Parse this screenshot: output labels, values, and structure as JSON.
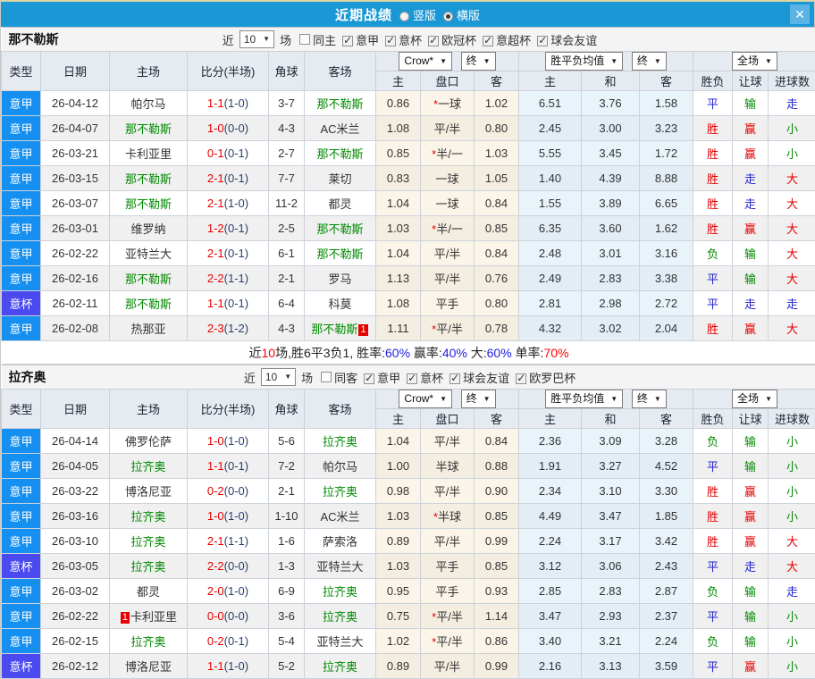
{
  "header": {
    "title": "近期战绩",
    "layout_options": [
      {
        "label": "竖版",
        "selected": false
      },
      {
        "label": "横版",
        "selected": true
      }
    ]
  },
  "table": {
    "columns": [
      "类型",
      "日期",
      "主场",
      "比分(半场)",
      "角球",
      "客场"
    ],
    "subcolumns": [
      "主",
      "盘口",
      "客",
      "主",
      "和",
      "客",
      "胜负",
      "让球",
      "进球数"
    ],
    "dropdowns": {
      "provider": "Crow*",
      "final_a": "终",
      "average": "胜平负均值",
      "final_b": "终",
      "scope": "全场"
    }
  },
  "colors": {
    "type": {
      "意甲": "#1590f0",
      "意杯": "#4a4af0"
    },
    "result": {
      "胜": "res-red",
      "赢": "res-red",
      "大": "res-red",
      "平": "res-blue",
      "走": "res-blue",
      "负": "res-green",
      "输": "res-green",
      "小": "res-green"
    },
    "focus_team": "#008a00",
    "score": "#e60000",
    "title_bar": "#1a98d5"
  },
  "sections": [
    {
      "team": "那不勒斯",
      "filters": {
        "near_label": "近",
        "count": "10",
        "unit": "场",
        "same_label": "同主",
        "same_checked": false,
        "leagues": [
          {
            "label": "意甲",
            "checked": true
          },
          {
            "label": "意杯",
            "checked": true
          },
          {
            "label": "欧冠杯",
            "checked": true
          },
          {
            "label": "意超杯",
            "checked": true
          },
          {
            "label": "球会友谊",
            "checked": true
          }
        ]
      },
      "rows": [
        {
          "type": "意甲",
          "date": "26-04-12",
          "home": {
            "name": "帕尔马"
          },
          "score": "1-1",
          "half": "(1-0)",
          "corner": "3-7",
          "away": {
            "name": "那不勒斯",
            "focus": true
          },
          "asian": [
            "0.86",
            "*一球",
            "1.02"
          ],
          "euro": [
            "6.51",
            "3.76",
            "1.58"
          ],
          "results": [
            "平",
            "输",
            "走"
          ]
        },
        {
          "type": "意甲",
          "date": "26-04-07",
          "home": {
            "name": "那不勒斯",
            "focus": true
          },
          "score": "1-0",
          "half": "(0-0)",
          "corner": "4-3",
          "away": {
            "name": "AC米兰"
          },
          "asian": [
            "1.08",
            "平/半",
            "0.80"
          ],
          "euro": [
            "2.45",
            "3.00",
            "3.23"
          ],
          "results": [
            "胜",
            "赢",
            "小"
          ]
        },
        {
          "type": "意甲",
          "date": "26-03-21",
          "home": {
            "name": "卡利亚里"
          },
          "score": "0-1",
          "half": "(0-1)",
          "corner": "2-7",
          "away": {
            "name": "那不勒斯",
            "focus": true
          },
          "asian": [
            "0.85",
            "*半/一",
            "1.03"
          ],
          "euro": [
            "5.55",
            "3.45",
            "1.72"
          ],
          "results": [
            "胜",
            "赢",
            "小"
          ]
        },
        {
          "type": "意甲",
          "date": "26-03-15",
          "home": {
            "name": "那不勒斯",
            "focus": true
          },
          "score": "2-1",
          "half": "(0-1)",
          "corner": "7-7",
          "away": {
            "name": "莱切"
          },
          "asian": [
            "0.83",
            "一球",
            "1.05"
          ],
          "euro": [
            "1.40",
            "4.39",
            "8.88"
          ],
          "results": [
            "胜",
            "走",
            "大"
          ]
        },
        {
          "type": "意甲",
          "date": "26-03-07",
          "home": {
            "name": "那不勒斯",
            "focus": true
          },
          "score": "2-1",
          "half": "(1-0)",
          "corner": "11-2",
          "away": {
            "name": "都灵"
          },
          "asian": [
            "1.04",
            "一球",
            "0.84"
          ],
          "euro": [
            "1.55",
            "3.89",
            "6.65"
          ],
          "results": [
            "胜",
            "走",
            "大"
          ]
        },
        {
          "type": "意甲",
          "date": "26-03-01",
          "home": {
            "name": "维罗纳"
          },
          "score": "1-2",
          "half": "(0-1)",
          "corner": "2-5",
          "away": {
            "name": "那不勒斯",
            "focus": true
          },
          "asian": [
            "1.03",
            "*半/一",
            "0.85"
          ],
          "euro": [
            "6.35",
            "3.60",
            "1.62"
          ],
          "results": [
            "胜",
            "赢",
            "大"
          ]
        },
        {
          "type": "意甲",
          "date": "26-02-22",
          "home": {
            "name": "亚特兰大"
          },
          "score": "2-1",
          "half": "(0-1)",
          "corner": "6-1",
          "away": {
            "name": "那不勒斯",
            "focus": true
          },
          "asian": [
            "1.04",
            "平/半",
            "0.84"
          ],
          "euro": [
            "2.48",
            "3.01",
            "3.16"
          ],
          "results": [
            "负",
            "输",
            "大"
          ]
        },
        {
          "type": "意甲",
          "date": "26-02-16",
          "home": {
            "name": "那不勒斯",
            "focus": true
          },
          "score": "2-2",
          "half": "(1-1)",
          "corner": "2-1",
          "away": {
            "name": "罗马"
          },
          "asian": [
            "1.13",
            "平/半",
            "0.76"
          ],
          "euro": [
            "2.49",
            "2.83",
            "3.38"
          ],
          "results": [
            "平",
            "输",
            "大"
          ]
        },
        {
          "type": "意杯",
          "date": "26-02-11",
          "home": {
            "name": "那不勒斯",
            "focus": true
          },
          "score": "1-1",
          "half": "(0-1)",
          "corner": "6-4",
          "away": {
            "name": "科莫"
          },
          "asian": [
            "1.08",
            "平手",
            "0.80"
          ],
          "euro": [
            "2.81",
            "2.98",
            "2.72"
          ],
          "results": [
            "平",
            "走",
            "走"
          ]
        },
        {
          "type": "意甲",
          "date": "26-02-08",
          "home": {
            "name": "热那亚"
          },
          "score": "2-3",
          "half": "(1-2)",
          "corner": "4-3",
          "away": {
            "name": "那不勒斯",
            "focus": true,
            "badge": "1",
            "badge_pos": "after"
          },
          "asian": [
            "1.11",
            "*平/半",
            "0.78"
          ],
          "euro": [
            "4.32",
            "3.02",
            "2.04"
          ],
          "results": [
            "胜",
            "赢",
            "大"
          ]
        }
      ],
      "summary": [
        {
          "t": "近",
          "c": "k"
        },
        {
          "t": "10",
          "c": "r"
        },
        {
          "t": "场,胜6平3负1, 胜率:",
          "c": "k"
        },
        {
          "t": "60%",
          "c": "b"
        },
        {
          "t": " 赢率:",
          "c": "k"
        },
        {
          "t": "40%",
          "c": "b"
        },
        {
          "t": " 大:",
          "c": "k"
        },
        {
          "t": "60%",
          "c": "b"
        },
        {
          "t": " 单率:",
          "c": "k"
        },
        {
          "t": "70%",
          "c": "r"
        }
      ]
    },
    {
      "team": "拉齐奥",
      "filters": {
        "near_label": "近",
        "count": "10",
        "unit": "场",
        "same_label": "同客",
        "same_checked": false,
        "leagues": [
          {
            "label": "意甲",
            "checked": true
          },
          {
            "label": "意杯",
            "checked": true
          },
          {
            "label": "球会友谊",
            "checked": true
          },
          {
            "label": "欧罗巴杯",
            "checked": true
          }
        ]
      },
      "rows": [
        {
          "type": "意甲",
          "date": "26-04-14",
          "home": {
            "name": "佛罗伦萨"
          },
          "score": "1-0",
          "half": "(1-0)",
          "corner": "5-6",
          "away": {
            "name": "拉齐奥",
            "focus": true
          },
          "asian": [
            "1.04",
            "平/半",
            "0.84"
          ],
          "euro": [
            "2.36",
            "3.09",
            "3.28"
          ],
          "results": [
            "负",
            "输",
            "小"
          ]
        },
        {
          "type": "意甲",
          "date": "26-04-05",
          "home": {
            "name": "拉齐奥",
            "focus": true
          },
          "score": "1-1",
          "half": "(0-1)",
          "corner": "7-2",
          "away": {
            "name": "帕尔马"
          },
          "asian": [
            "1.00",
            "半球",
            "0.88"
          ],
          "euro": [
            "1.91",
            "3.27",
            "4.52"
          ],
          "results": [
            "平",
            "输",
            "小"
          ]
        },
        {
          "type": "意甲",
          "date": "26-03-22",
          "home": {
            "name": "博洛尼亚"
          },
          "score": "0-2",
          "half": "(0-0)",
          "corner": "2-1",
          "away": {
            "name": "拉齐奥",
            "focus": true
          },
          "asian": [
            "0.98",
            "平/半",
            "0.90"
          ],
          "euro": [
            "2.34",
            "3.10",
            "3.30"
          ],
          "results": [
            "胜",
            "赢",
            "小"
          ]
        },
        {
          "type": "意甲",
          "date": "26-03-16",
          "home": {
            "name": "拉齐奥",
            "focus": true
          },
          "score": "1-0",
          "half": "(1-0)",
          "corner": "1-10",
          "away": {
            "name": "AC米兰"
          },
          "asian": [
            "1.03",
            "*半球",
            "0.85"
          ],
          "euro": [
            "4.49",
            "3.47",
            "1.85"
          ],
          "results": [
            "胜",
            "赢",
            "小"
          ]
        },
        {
          "type": "意甲",
          "date": "26-03-10",
          "home": {
            "name": "拉齐奥",
            "focus": true
          },
          "score": "2-1",
          "half": "(1-1)",
          "corner": "1-6",
          "away": {
            "name": "萨索洛"
          },
          "asian": [
            "0.89",
            "平/半",
            "0.99"
          ],
          "euro": [
            "2.24",
            "3.17",
            "3.42"
          ],
          "results": [
            "胜",
            "赢",
            "大"
          ]
        },
        {
          "type": "意杯",
          "date": "26-03-05",
          "home": {
            "name": "拉齐奥",
            "focus": true
          },
          "score": "2-2",
          "half": "(0-0)",
          "corner": "1-3",
          "away": {
            "name": "亚特兰大"
          },
          "asian": [
            "1.03",
            "平手",
            "0.85"
          ],
          "euro": [
            "3.12",
            "3.06",
            "2.43"
          ],
          "results": [
            "平",
            "走",
            "大"
          ]
        },
        {
          "type": "意甲",
          "date": "26-03-02",
          "home": {
            "name": "都灵"
          },
          "score": "2-0",
          "half": "(1-0)",
          "corner": "6-9",
          "away": {
            "name": "拉齐奥",
            "focus": true
          },
          "asian": [
            "0.95",
            "平手",
            "0.93"
          ],
          "euro": [
            "2.85",
            "2.83",
            "2.87"
          ],
          "results": [
            "负",
            "输",
            "走"
          ]
        },
        {
          "type": "意甲",
          "date": "26-02-22",
          "home": {
            "name": "卡利亚里",
            "badge": "1",
            "badge_pos": "before"
          },
          "score": "0-0",
          "half": "(0-0)",
          "corner": "3-6",
          "away": {
            "name": "拉齐奥",
            "focus": true
          },
          "asian": [
            "0.75",
            "*平/半",
            "1.14"
          ],
          "euro": [
            "3.47",
            "2.93",
            "2.37"
          ],
          "results": [
            "平",
            "输",
            "小"
          ]
        },
        {
          "type": "意甲",
          "date": "26-02-15",
          "home": {
            "name": "拉齐奥",
            "focus": true
          },
          "score": "0-2",
          "half": "(0-1)",
          "corner": "5-4",
          "away": {
            "name": "亚特兰大"
          },
          "asian": [
            "1.02",
            "*平/半",
            "0.86"
          ],
          "euro": [
            "3.40",
            "3.21",
            "2.24"
          ],
          "results": [
            "负",
            "输",
            "小"
          ]
        },
        {
          "type": "意杯",
          "date": "26-02-12",
          "home": {
            "name": "博洛尼亚"
          },
          "score": "1-1",
          "half": "(1-0)",
          "corner": "5-2",
          "away": {
            "name": "拉齐奥",
            "focus": true
          },
          "asian": [
            "0.89",
            "平/半",
            "0.99"
          ],
          "euro": [
            "2.16",
            "3.13",
            "3.59"
          ],
          "results": [
            "平",
            "赢",
            "小"
          ]
        }
      ]
    }
  ]
}
